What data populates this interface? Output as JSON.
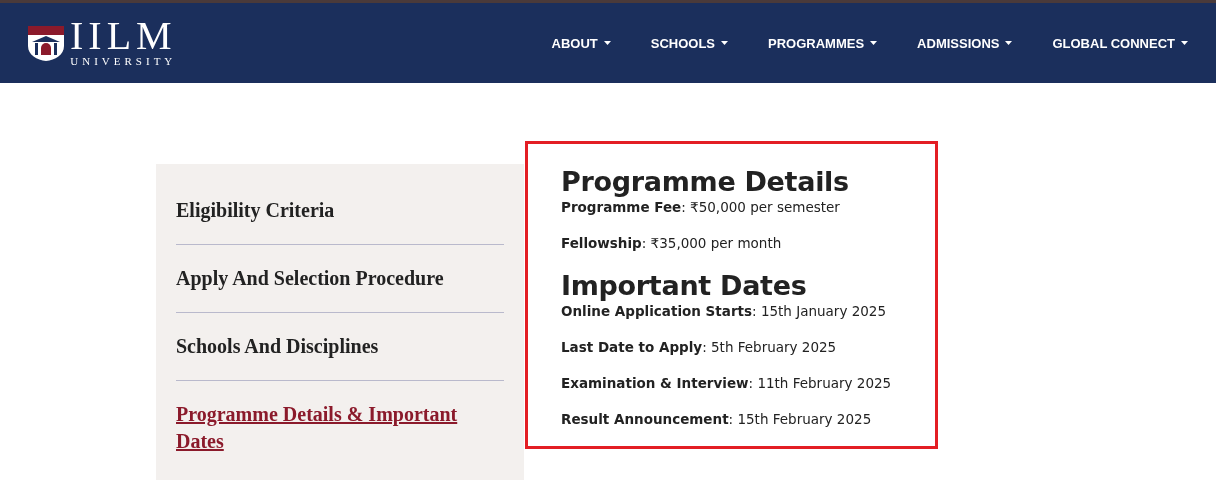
{
  "header": {
    "logo": {
      "name": "IILM",
      "subtitle": "UNIVERSITY"
    },
    "nav": [
      {
        "label": "ABOUT"
      },
      {
        "label": "SCHOOLS"
      },
      {
        "label": "PROGRAMMES"
      },
      {
        "label": "ADMISSIONS"
      },
      {
        "label": "GLOBAL CONNECT"
      }
    ]
  },
  "sidebar": {
    "items": [
      {
        "label": "Eligibility Criteria",
        "selected": false
      },
      {
        "label": "Apply And Selection Procedure",
        "selected": false
      },
      {
        "label": "Schools And Disciplines",
        "selected": false
      },
      {
        "label": "Programme Details & Important Dates",
        "selected": true
      }
    ]
  },
  "details": {
    "sections": [
      {
        "heading": "Programme Details",
        "lines": [
          "**Programme Fee**: ₹50,000 per semester",
          "**Fellowship**: ₹35,000 per month"
        ]
      },
      {
        "heading": "Important Dates",
        "lines": [
          "**Online Application Starts**: 15th January 2025",
          "**Last Date to Apply**: 5th February 2025",
          "**Examination & Interview**: 11th February 2025",
          "**Result Announcement**: 15th February 2025"
        ]
      }
    ]
  }
}
